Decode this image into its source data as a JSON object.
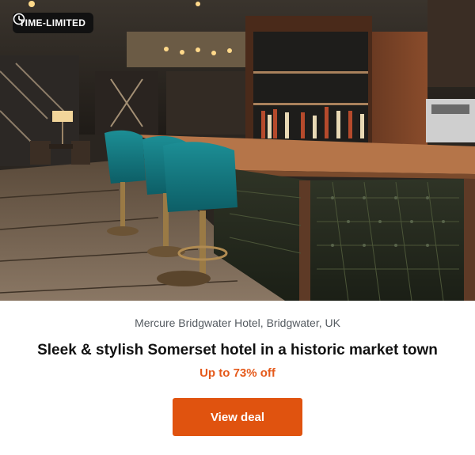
{
  "badge": {
    "label": "TIME-LIMITED",
    "icon": "clock-icon"
  },
  "hotel": {
    "location": "Mercure Bridgwater Hotel, Bridgwater, UK",
    "title": "Sleek & stylish Somerset hotel in a historic market town",
    "discount": "Up to 73% off"
  },
  "cta": {
    "label": "View deal"
  },
  "colors": {
    "accent": "#e0530f",
    "discount_text": "#e55a1b",
    "badge_bg": "#111111"
  }
}
